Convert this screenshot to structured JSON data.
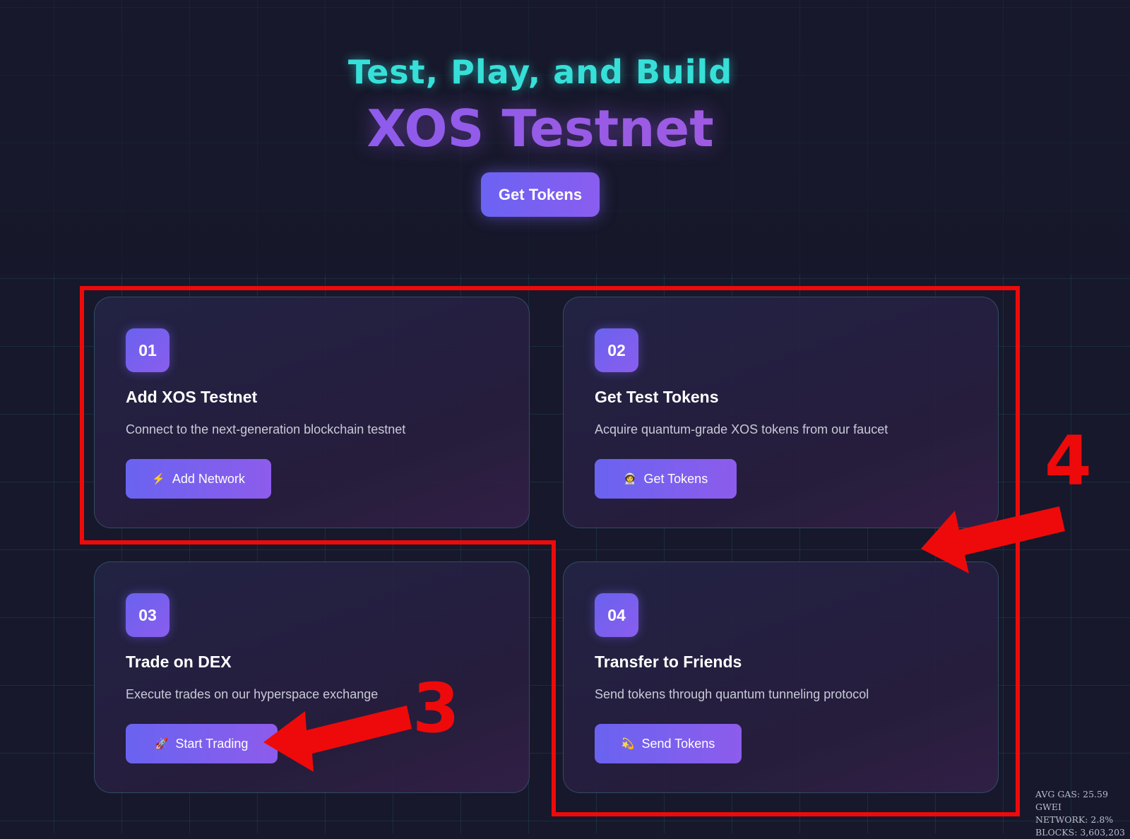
{
  "hero": {
    "tagline": "Test, Play, and Build",
    "title": "XOS Testnet",
    "cta_label": "Get Tokens"
  },
  "steps": [
    {
      "number": "01",
      "title": "Add XOS Testnet",
      "description": "Connect to the next-generation blockchain testnet",
      "button_icon": "⚡",
      "button_label": "Add Network",
      "icon_name": "lightning-icon"
    },
    {
      "number": "02",
      "title": "Get Test Tokens",
      "description": "Acquire quantum-grade XOS tokens from our faucet",
      "button_icon": "🧑‍🚀",
      "button_label": "Get Tokens",
      "icon_name": "astronaut-icon"
    },
    {
      "number": "03",
      "title": "Trade on DEX",
      "description": "Execute trades on our hyperspace exchange",
      "button_icon": "🚀",
      "button_label": "Start Trading",
      "icon_name": "rocket-icon"
    },
    {
      "number": "04",
      "title": "Transfer to Friends",
      "description": "Send tokens through quantum tunneling protocol",
      "button_icon": "💫",
      "button_label": "Send Tokens",
      "icon_name": "comet-icon"
    }
  ],
  "annotations": {
    "label_3": "3",
    "label_4": "4",
    "color": "#ee0a0a"
  },
  "network_stats": {
    "avg_gas": "AVG GAS: 25.59 GWEI",
    "network": "NETWORK: 2.8%",
    "blocks": "BLOCKS: 3,603,203"
  },
  "colors": {
    "background": "#17182b",
    "accent_teal": "#36e0d8",
    "accent_purple": "#8a5df0",
    "annotation_red": "#ee0a0a"
  }
}
